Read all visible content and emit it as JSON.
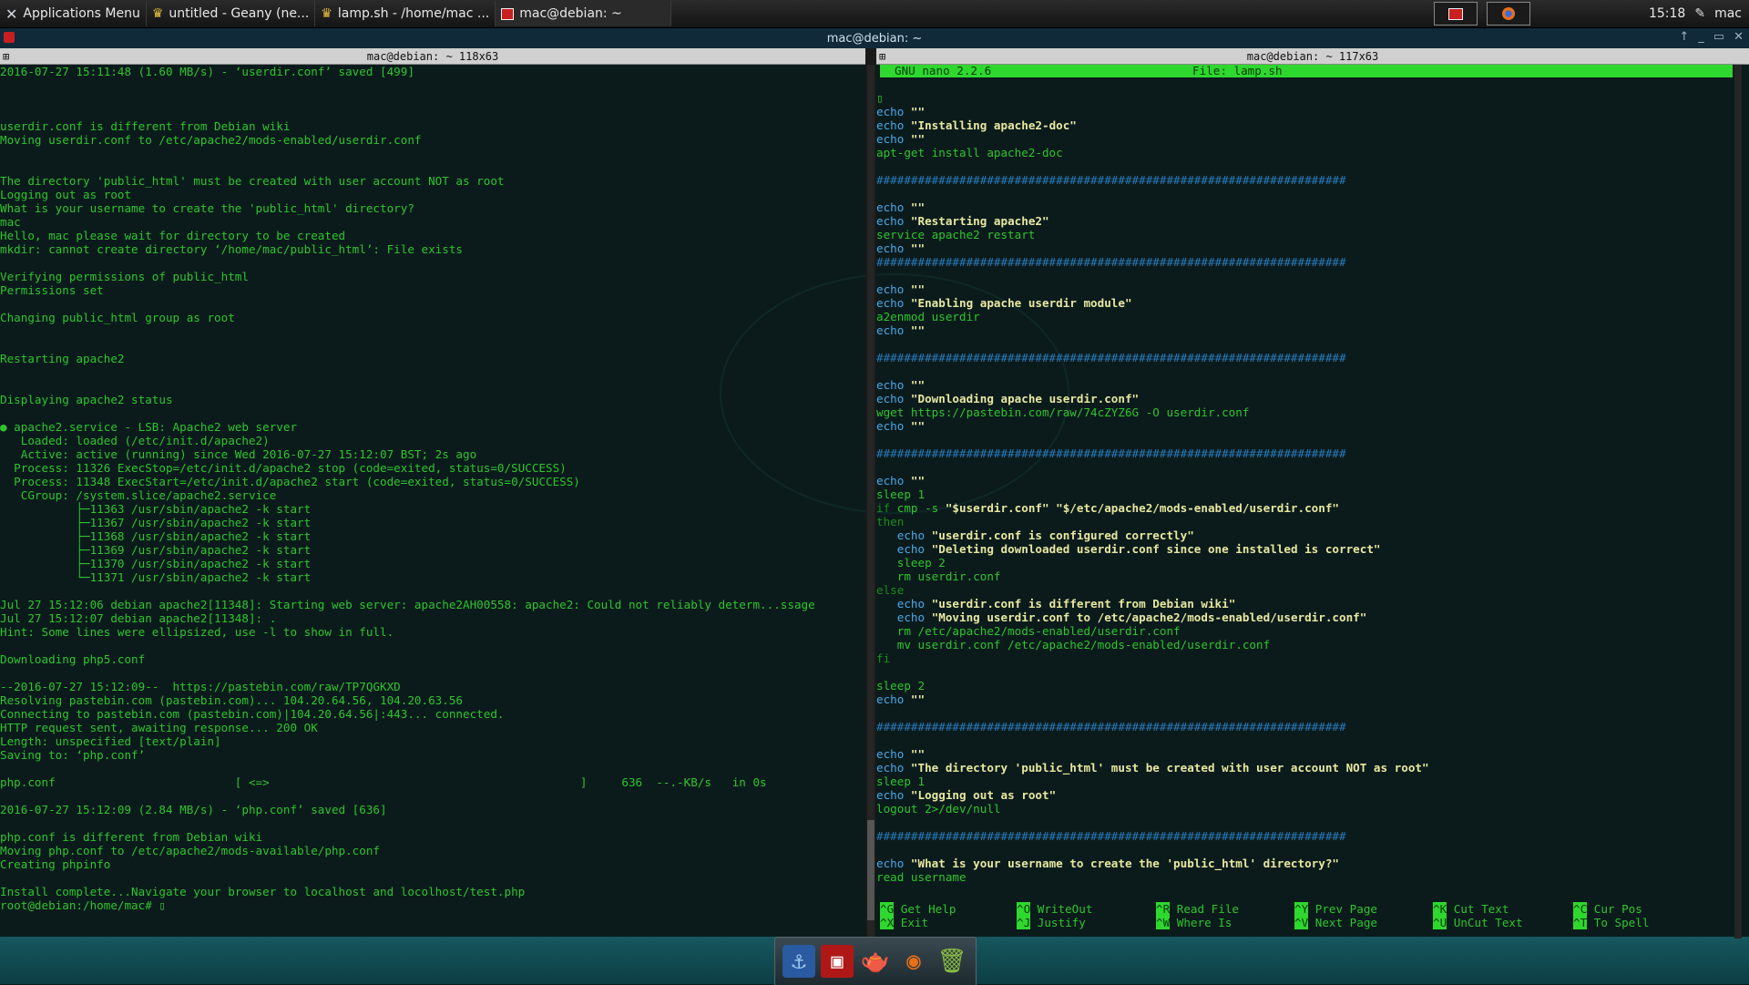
{
  "panel": {
    "apps_menu": "Applications Menu",
    "tasks": [
      {
        "label": "untitled - Geany (ne...",
        "icon": "geany-icon"
      },
      {
        "label": "lamp.sh - /home/mac ...",
        "icon": "geany-icon"
      },
      {
        "label": "mac@debian: ~",
        "icon": "terminal-icon"
      }
    ],
    "clock": "15:18",
    "user": "mac"
  },
  "window": {
    "title": "mac@debian: ~",
    "left_title": "mac@debian: ~ 118x63",
    "right_title": "mac@debian: ~ 117x63"
  },
  "left_terminal": [
    {
      "t": "2016-07-27 15:11:48 (1.60 MB/s) - ‘userdir.conf’ saved [499]"
    },
    {
      "t": ""
    },
    {
      "t": ""
    },
    {
      "t": ""
    },
    {
      "t": "userdir.conf is different from Debian wiki"
    },
    {
      "t": "Moving userdir.conf to /etc/apache2/mods-enabled/userdir.conf"
    },
    {
      "t": ""
    },
    {
      "t": ""
    },
    {
      "t": "The directory 'public_html' must be created with user account NOT as root"
    },
    {
      "t": "Logging out as root"
    },
    {
      "t": "What is your username to create the 'public_html' directory?"
    },
    {
      "t": "mac"
    },
    {
      "t": "Hello, mac please wait for directory to be created"
    },
    {
      "t": "mkdir: cannot create directory ‘/home/mac/public_html’: File exists"
    },
    {
      "t": ""
    },
    {
      "t": "Verifying permissions of public_html"
    },
    {
      "t": "Permissions set"
    },
    {
      "t": ""
    },
    {
      "t": "Changing public_html group as root"
    },
    {
      "t": ""
    },
    {
      "t": ""
    },
    {
      "t": "Restarting apache2"
    },
    {
      "t": ""
    },
    {
      "t": ""
    },
    {
      "t": "Displaying apache2 status"
    },
    {
      "t": ""
    },
    {
      "t": "● apache2.service - LSB: Apache2 web server"
    },
    {
      "t": "   Loaded: loaded (/etc/init.d/apache2)"
    },
    {
      "t": "   Active: active (running) since Wed 2016-07-27 15:12:07 BST; 2s ago"
    },
    {
      "t": "  Process: 11326 ExecStop=/etc/init.d/apache2 stop (code=exited, status=0/SUCCESS)"
    },
    {
      "t": "  Process: 11348 ExecStart=/etc/init.d/apache2 start (code=exited, status=0/SUCCESS)"
    },
    {
      "t": "   CGroup: /system.slice/apache2.service"
    },
    {
      "t": "           ├─11363 /usr/sbin/apache2 -k start"
    },
    {
      "t": "           ├─11367 /usr/sbin/apache2 -k start"
    },
    {
      "t": "           ├─11368 /usr/sbin/apache2 -k start"
    },
    {
      "t": "           ├─11369 /usr/sbin/apache2 -k start"
    },
    {
      "t": "           ├─11370 /usr/sbin/apache2 -k start"
    },
    {
      "t": "           └─11371 /usr/sbin/apache2 -k start"
    },
    {
      "t": ""
    },
    {
      "t": "Jul 27 15:12:06 debian apache2[11348]: Starting web server: apache2AH00558: apache2: Could not reliably determ...ssage"
    },
    {
      "t": "Jul 27 15:12:07 debian apache2[11348]: ."
    },
    {
      "t": "Hint: Some lines were ellipsized, use -l to show in full."
    },
    {
      "t": ""
    },
    {
      "t": "Downloading php5.conf"
    },
    {
      "t": ""
    },
    {
      "t": "--2016-07-27 15:12:09--  https://pastebin.com/raw/TP7QGKXD"
    },
    {
      "t": "Resolving pastebin.com (pastebin.com)... 104.20.64.56, 104.20.63.56"
    },
    {
      "t": "Connecting to pastebin.com (pastebin.com)|104.20.64.56|:443... connected."
    },
    {
      "t": "HTTP request sent, awaiting response... 200 OK"
    },
    {
      "t": "Length: unspecified [text/plain]"
    },
    {
      "t": "Saving to: ‘php.conf’"
    },
    {
      "t": ""
    },
    {
      "t": "php.conf                          [ <=>                                             ]     636  --.-KB/s   in 0s"
    },
    {
      "t": ""
    },
    {
      "t": "2016-07-27 15:12:09 (2.84 MB/s) - ‘php.conf’ saved [636]"
    },
    {
      "t": ""
    },
    {
      "t": "php.conf is different from Debian wiki"
    },
    {
      "t": "Moving php.conf to /etc/apache2/mods-available/php.conf"
    },
    {
      "t": "Creating phpinfo"
    },
    {
      "t": ""
    },
    {
      "t": "Install complete...Navigate your browser to localhost and locolhost/test.php"
    },
    {
      "t": "root@debian:/home/mac# ▯"
    }
  ],
  "nano": {
    "version": "GNU nano 2.2.6",
    "file": "File: lamp.sh",
    "lines": [
      {
        "t": "▯",
        "c": "g"
      },
      {
        "t": "echo \"\"",
        "c": "echo"
      },
      {
        "t": "echo \"Installing apache2-doc\"",
        "c": "echo"
      },
      {
        "t": "echo \"\"",
        "c": "echo"
      },
      {
        "t": "apt-get install apache2-doc",
        "c": "g"
      },
      {
        "t": "",
        "c": "g"
      },
      {
        "t": "####################################################################",
        "c": "hash"
      },
      {
        "t": "",
        "c": "g"
      },
      {
        "t": "echo \"\"",
        "c": "echo"
      },
      {
        "t": "echo \"Restarting apache2\"",
        "c": "echo"
      },
      {
        "t": "service apache2 restart",
        "c": "g"
      },
      {
        "t": "echo \"\"",
        "c": "echo"
      },
      {
        "t": "####################################################################",
        "c": "hash"
      },
      {
        "t": "",
        "c": "g"
      },
      {
        "t": "echo \"\"",
        "c": "echo"
      },
      {
        "t": "echo \"Enabling apache userdir module\"",
        "c": "echo"
      },
      {
        "t": "a2enmod userdir",
        "c": "g"
      },
      {
        "t": "echo \"\"",
        "c": "echo"
      },
      {
        "t": "",
        "c": "g"
      },
      {
        "t": "####################################################################",
        "c": "hash"
      },
      {
        "t": "",
        "c": "g"
      },
      {
        "t": "echo \"\"",
        "c": "echo"
      },
      {
        "t": "echo \"Downloading apache userdir.conf\"",
        "c": "echo"
      },
      {
        "t": "wget https://pastebin.com/raw/74cZYZ6G -O userdir.conf",
        "c": "g"
      },
      {
        "t": "echo \"\"",
        "c": "echo"
      },
      {
        "t": "",
        "c": "g"
      },
      {
        "t": "####################################################################",
        "c": "hash"
      },
      {
        "t": "",
        "c": "g"
      },
      {
        "t": "echo \"\"",
        "c": "echo"
      },
      {
        "t": "sleep 1",
        "c": "g"
      },
      {
        "t": "if cmp -s \"$userdir.conf\" \"$/etc/apache2/mods-enabled/userdir.conf\"",
        "c": "if"
      },
      {
        "t": "then",
        "c": "dg"
      },
      {
        "t": "   echo \"userdir.conf is configured correctly\"",
        "c": "echo"
      },
      {
        "t": "   echo \"Deleting downloaded userdir.conf since one installed is correct\"",
        "c": "echo"
      },
      {
        "t": "   sleep 2",
        "c": "g"
      },
      {
        "t": "   rm userdir.conf",
        "c": "g"
      },
      {
        "t": "else",
        "c": "dg"
      },
      {
        "t": "   echo \"userdir.conf is different from Debian wiki\"",
        "c": "echo"
      },
      {
        "t": "   echo \"Moving userdir.conf to /etc/apache2/mods-enabled/userdir.conf\"",
        "c": "echo"
      },
      {
        "t": "   rm /etc/apache2/mods-enabled/userdir.conf",
        "c": "g"
      },
      {
        "t": "   mv userdir.conf /etc/apache2/mods-enabled/userdir.conf",
        "c": "g"
      },
      {
        "t": "fi",
        "c": "dg"
      },
      {
        "t": "",
        "c": "g"
      },
      {
        "t": "sleep 2",
        "c": "g"
      },
      {
        "t": "echo \"\"",
        "c": "echo"
      },
      {
        "t": "",
        "c": "g"
      },
      {
        "t": "####################################################################",
        "c": "hash"
      },
      {
        "t": "",
        "c": "g"
      },
      {
        "t": "echo \"\"",
        "c": "echo"
      },
      {
        "t": "echo \"The directory 'public_html' must be created with user account NOT as root\"",
        "c": "echo"
      },
      {
        "t": "sleep 1",
        "c": "g"
      },
      {
        "t": "echo \"Logging out as root\"",
        "c": "echo"
      },
      {
        "t": "logout 2>/dev/null",
        "c": "g"
      },
      {
        "t": "",
        "c": "g"
      },
      {
        "t": "####################################################################",
        "c": "hash"
      },
      {
        "t": "",
        "c": "g"
      },
      {
        "t": "echo \"What is your username to create the 'public_html' directory?\"",
        "c": "echo"
      },
      {
        "t": "read username",
        "c": "g"
      }
    ],
    "help": [
      {
        "k": "^G",
        "l": "Get Help"
      },
      {
        "k": "^O",
        "l": "WriteOut"
      },
      {
        "k": "^R",
        "l": "Read File"
      },
      {
        "k": "^Y",
        "l": "Prev Page"
      },
      {
        "k": "^K",
        "l": "Cut Text"
      },
      {
        "k": "^C",
        "l": "Cur Pos"
      },
      {
        "k": "^X",
        "l": "Exit"
      },
      {
        "k": "^J",
        "l": "Justify"
      },
      {
        "k": "^W",
        "l": "Where Is"
      },
      {
        "k": "^V",
        "l": "Next Page"
      },
      {
        "k": "^U",
        "l": "UnCut Text"
      },
      {
        "k": "^T",
        "l": "To Spell"
      }
    ]
  },
  "dock": [
    {
      "name": "anchor-icon",
      "glyph": "⚓"
    },
    {
      "name": "terminal-icon",
      "glyph": "▣"
    },
    {
      "name": "geany-icon",
      "glyph": "🫖"
    },
    {
      "name": "firefox-icon",
      "glyph": "◉"
    },
    {
      "name": "trash-icon",
      "glyph": "🗑"
    }
  ]
}
